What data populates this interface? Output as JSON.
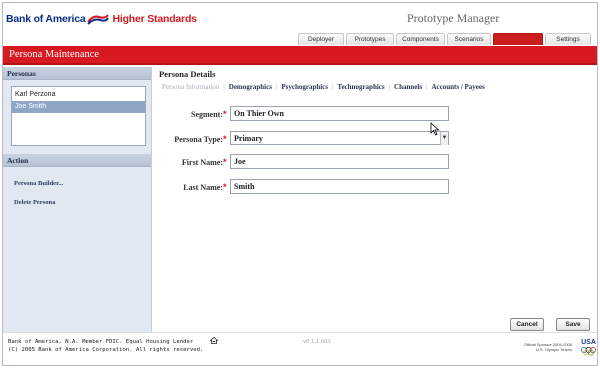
{
  "header": {
    "logo_boa": "Bank of America",
    "logo_tagline": "Higher Standards",
    "app_title": "Prototype Manager"
  },
  "tabs": [
    {
      "label": "Deployer",
      "active": false
    },
    {
      "label": "Prototypes",
      "active": false
    },
    {
      "label": "Components",
      "active": false
    },
    {
      "label": "Scenarios",
      "active": false
    },
    {
      "label": "Personas",
      "active": true
    },
    {
      "label": "Settings",
      "active": false
    }
  ],
  "page_title": "Persona Maintenance",
  "sidebar": {
    "personas_heading": "Personas",
    "personas": [
      {
        "name": "Karl Perzona",
        "selected": false
      },
      {
        "name": "Joe Smith",
        "selected": true
      }
    ],
    "action_heading": "Action",
    "actions": [
      "Persona Builder...",
      "Delete Persona"
    ]
  },
  "details": {
    "title": "Persona Details",
    "subtabs": [
      {
        "label": "Persona Information",
        "active": true
      },
      {
        "label": "Demographics",
        "active": false
      },
      {
        "label": "Psychographics",
        "active": false
      },
      {
        "label": "Technographics",
        "active": false
      },
      {
        "label": "Channels",
        "active": false
      },
      {
        "label": "Accounts / Payees",
        "active": false
      }
    ],
    "fields": {
      "segment": {
        "label": "Segment:",
        "value": "On Thier Own"
      },
      "persona_type": {
        "label": "Persona Type:",
        "value": "Primary"
      },
      "first_name": {
        "label": "First Name:",
        "value": "Joe"
      },
      "last_name": {
        "label": "Last Name:",
        "value": "Smith"
      }
    },
    "required_mark": "*",
    "cancel_label": "Cancel",
    "save_label": "Save"
  },
  "footer": {
    "line1": "Bank of America, N.A. Member FDIC. Equal Housing Lender",
    "line2": "(C) 2005 Bank of America Corporation. All rights reserved.",
    "version": "v0.1.1.663",
    "sponsor_line1": "Official Sponsor 2004-2008",
    "sponsor_line2": "U.S. Olympic Teams",
    "usa": "USA"
  },
  "colors": {
    "brand_red": "#d71921",
    "brand_blue": "#0a2f8a",
    "sidebar_bg": "#e2e8f2",
    "selected_row": "#8fa6c7"
  }
}
